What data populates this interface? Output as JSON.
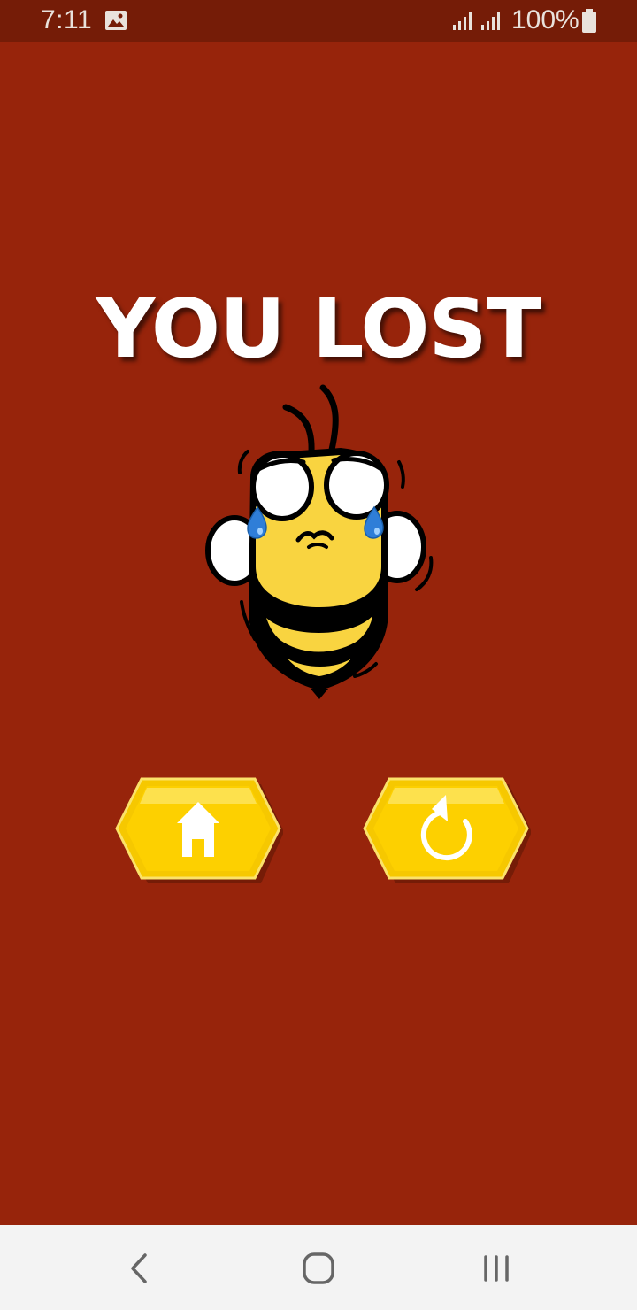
{
  "status_bar": {
    "time": "7:11",
    "battery": "100%",
    "icons": [
      "gallery-icon",
      "signal-icon",
      "signal-icon",
      "battery-icon"
    ]
  },
  "game_over": {
    "title": "YOU LOST",
    "mascot": "crying-bee"
  },
  "buttons": {
    "home_icon": "home-icon",
    "retry_icon": "retry-icon"
  },
  "nav_bar": {
    "icons": [
      "back-icon",
      "home-circle-icon",
      "recents-icon"
    ]
  },
  "colors": {
    "background": "#97240b",
    "status_bar": "#751c07",
    "button_gold": "#fdd000",
    "title_text": "#ffffff",
    "nav_bar": "#f3f3f3"
  }
}
